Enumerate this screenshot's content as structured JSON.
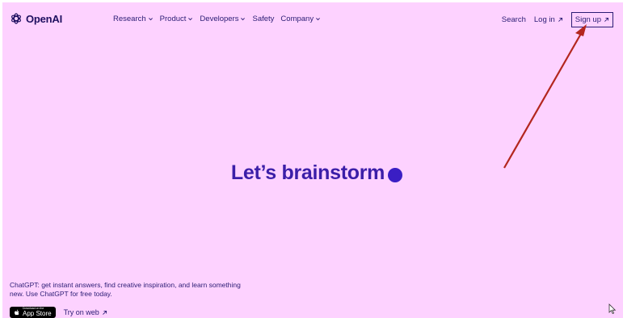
{
  "brand": {
    "name": "OpenAI"
  },
  "nav": {
    "items": [
      {
        "label": "Research",
        "icon": "chevron-down-icon"
      },
      {
        "label": "Product",
        "icon": "chevron-down-icon"
      },
      {
        "label": "Developers",
        "icon": "chevron-down-icon"
      },
      {
        "label": "Safety"
      },
      {
        "label": "Company",
        "icon": "chevron-down-icon"
      }
    ],
    "search_label": "Search",
    "login_label": "Log in",
    "signup_label": "Sign up"
  },
  "hero": {
    "headline": "Let’s brainstorm"
  },
  "footer": {
    "description": "ChatGPT: get instant answers, find creative inspiration, and learn something new. Use ChatGPT for free today.",
    "app_store_small": "Download on the",
    "app_store_big": "App Store",
    "try_web_label": "Try on web"
  },
  "colors": {
    "background": "#fdd2ff",
    "text": "#2b1c74",
    "hero": "#3b1ea8",
    "annotation": "#b3261e"
  }
}
